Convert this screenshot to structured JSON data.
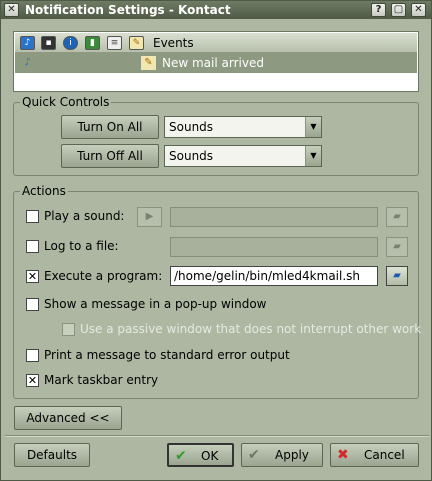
{
  "window": {
    "title": "Notification Settings - Kontact",
    "buttons": {
      "help": "?",
      "maximize": "▢",
      "close": "✕"
    },
    "menu_icon": "✕"
  },
  "events": {
    "header_label": "Events",
    "header_icons": [
      "sound-icon",
      "terminal-icon",
      "info-icon",
      "taskbar-icon",
      "log-icon",
      "event-icon"
    ],
    "rows": [
      {
        "label": "New mail arrived"
      }
    ]
  },
  "quick_controls": {
    "title": "Quick Controls",
    "turn_on_label": "Turn On All",
    "turn_off_label": "Turn Off All",
    "combo_on_value": "Sounds",
    "combo_off_value": "Sounds"
  },
  "actions": {
    "title": "Actions",
    "play_sound": {
      "label": "Play a sound:",
      "checked": false,
      "value": ""
    },
    "log_file": {
      "label": "Log to a file:",
      "checked": false,
      "value": ""
    },
    "execute_program": {
      "label": "Execute a program:",
      "checked": true,
      "value": "/home/gelin/bin/mled4kmail.sh"
    },
    "popup": {
      "label": "Show a message in a pop-up window",
      "checked": false
    },
    "passive": {
      "label": "Use a passive window that does not interrupt other work",
      "checked": false
    },
    "stderr": {
      "label": "Print a message to standard error output",
      "checked": false
    },
    "taskbar": {
      "label": "Mark taskbar entry",
      "checked": true
    }
  },
  "footer": {
    "advanced_label": "Advanced <<",
    "defaults_label": "Defaults",
    "ok_label": "OK",
    "apply_label": "Apply",
    "cancel_label": "Cancel"
  },
  "colors": {
    "window_bg": "#adb7a2",
    "selection": "#8d9981",
    "titlebar": "#4f5a46"
  }
}
